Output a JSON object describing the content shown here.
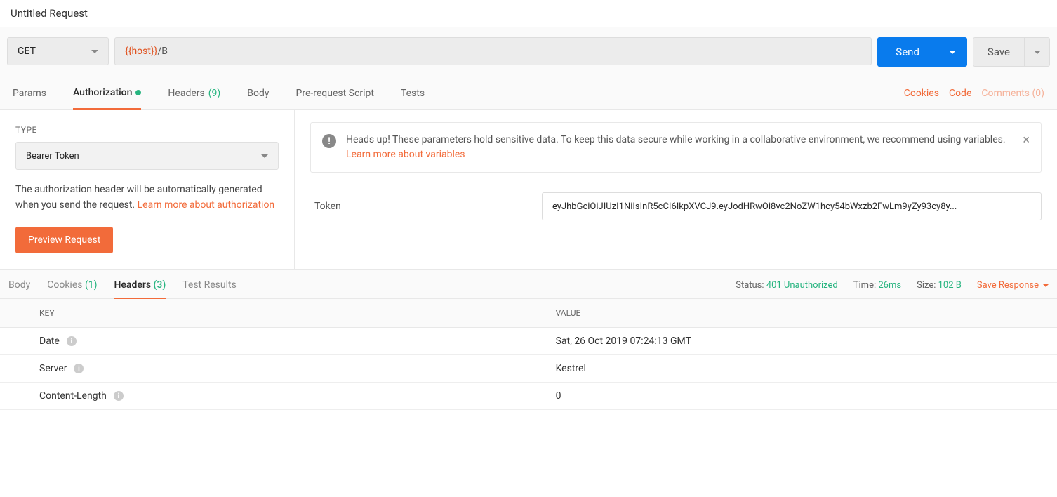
{
  "title": "Untitled Request",
  "method": "GET",
  "url": {
    "variable": "{{host}}",
    "path": "/B"
  },
  "actions": {
    "send": "Send",
    "save": "Save"
  },
  "request_tabs": {
    "params": "Params",
    "authorization": "Authorization",
    "headers": "Headers",
    "headers_count": "(9)",
    "body": "Body",
    "prerequest": "Pre-request Script",
    "tests": "Tests"
  },
  "request_links": {
    "cookies": "Cookies",
    "code": "Code",
    "comments": "Comments (0)"
  },
  "auth": {
    "type_label": "TYPE",
    "type_value": "Bearer Token",
    "desc_prefix": "The authorization header will be automatically generated when you send the request. ",
    "desc_link": "Learn more about authorization",
    "preview": "Preview Request",
    "alert_prefix": "Heads up! These parameters hold sensitive data. To keep this data secure while working in a collaborative environment, we recommend using variables. ",
    "alert_link": "Learn more about variables",
    "token_label": "Token",
    "token_value": "eyJhbGciOiJIUzI1NiIsInR5cCI6IkpXVCJ9.eyJodHRwOi8vc2NoZW1hcy54bWxzb2FwLm9yZy93cy8y..."
  },
  "response_tabs": {
    "body": "Body",
    "cookies": "Cookies",
    "cookies_count": "(1)",
    "headers": "Headers",
    "headers_count": "(3)",
    "test_results": "Test Results"
  },
  "response_meta": {
    "status_label": "Status:",
    "status_value": "401 Unauthorized",
    "time_label": "Time:",
    "time_value": "26ms",
    "size_label": "Size:",
    "size_value": "102 B",
    "save_response": "Save Response"
  },
  "headers_table": {
    "key_header": "KEY",
    "value_header": "VALUE",
    "rows": [
      {
        "key": "Date",
        "value": "Sat, 26 Oct 2019 07:24:13 GMT"
      },
      {
        "key": "Server",
        "value": "Kestrel"
      },
      {
        "key": "Content-Length",
        "value": "0"
      }
    ]
  }
}
